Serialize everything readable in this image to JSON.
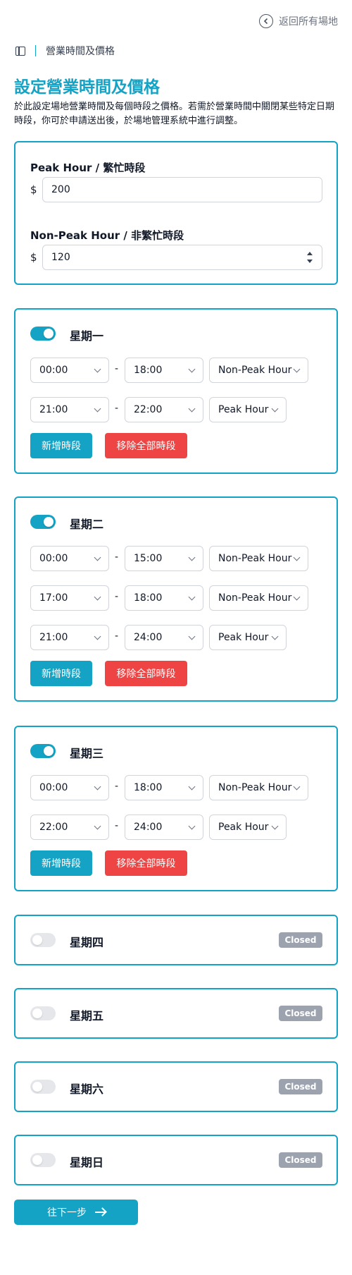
{
  "header": {
    "back_label": "返回所有場地"
  },
  "breadcrumb": {
    "label": "營業時間及價格"
  },
  "page": {
    "title": "設定營業時間及價格",
    "description": "於此設定場地營業時間及每個時段之價格。若需於營業時間中關閉某些特定日期時段，你可於申請送出後，於場地管理系統中進行調整。"
  },
  "pricing": {
    "currency": "$",
    "peak_label": "Peak Hour / 繁忙時段",
    "peak_value": "200",
    "nonpeak_label": "Non-Peak Hour / 非繁忙時段",
    "nonpeak_value": "120"
  },
  "days": [
    {
      "name": "星期一",
      "enabled": true,
      "slots": [
        {
          "start": "00:00",
          "end": "18:00",
          "type": "Non-Peak Hour"
        },
        {
          "start": "21:00",
          "end": "22:00",
          "type": "Peak Hour"
        }
      ]
    },
    {
      "name": "星期二",
      "enabled": true,
      "slots": [
        {
          "start": "00:00",
          "end": "15:00",
          "type": "Non-Peak Hour"
        },
        {
          "start": "17:00",
          "end": "18:00",
          "type": "Non-Peak Hour"
        },
        {
          "start": "21:00",
          "end": "24:00",
          "type": "Peak Hour"
        }
      ]
    },
    {
      "name": "星期三",
      "enabled": true,
      "slots": [
        {
          "start": "00:00",
          "end": "18:00",
          "type": "Non-Peak Hour"
        },
        {
          "start": "22:00",
          "end": "24:00",
          "type": "Peak Hour"
        }
      ]
    },
    {
      "name": "星期四",
      "enabled": false,
      "slots": []
    },
    {
      "name": "星期五",
      "enabled": false,
      "slots": []
    },
    {
      "name": "星期六",
      "enabled": false,
      "slots": []
    },
    {
      "name": "星期日",
      "enabled": false,
      "slots": []
    }
  ],
  "labels": {
    "range_separator": "-",
    "add_slot": "新增時段",
    "remove_all": "移除全部時段",
    "closed": "Closed",
    "next": "往下一步"
  },
  "colors": {
    "accent": "#14a3c4",
    "danger": "#ef4444",
    "closed": "#9ca3af"
  }
}
